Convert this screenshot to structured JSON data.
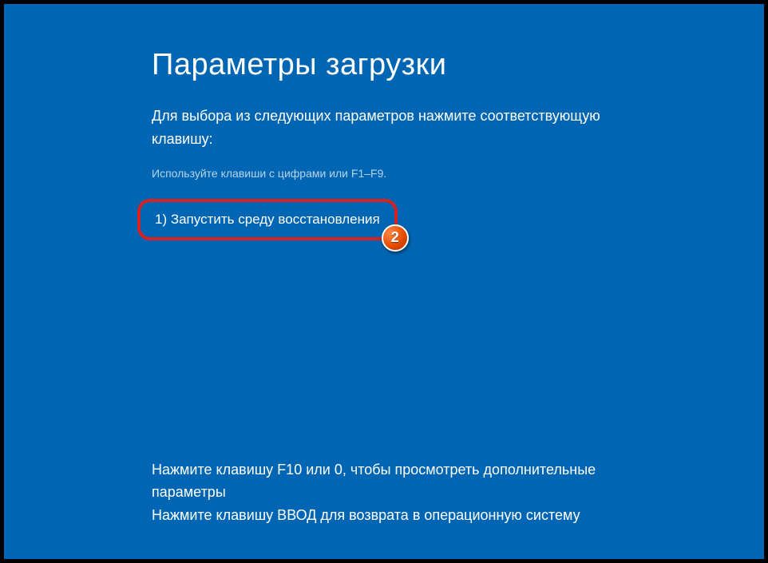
{
  "title": "Параметры загрузки",
  "instruction": "Для выбора из следующих параметров нажмите соответствующую клавишу:",
  "hint": "Используйте клавиши с цифрами или F1–F9.",
  "option": {
    "text": "1) Запустить среду восстановления"
  },
  "annotation": {
    "step_number": "2"
  },
  "footer": {
    "line1": "Нажмите клавишу F10 или 0, чтобы просмотреть дополнительные параметры",
    "line2": "Нажмите клавишу ВВОД для возврата в операционную систему"
  }
}
